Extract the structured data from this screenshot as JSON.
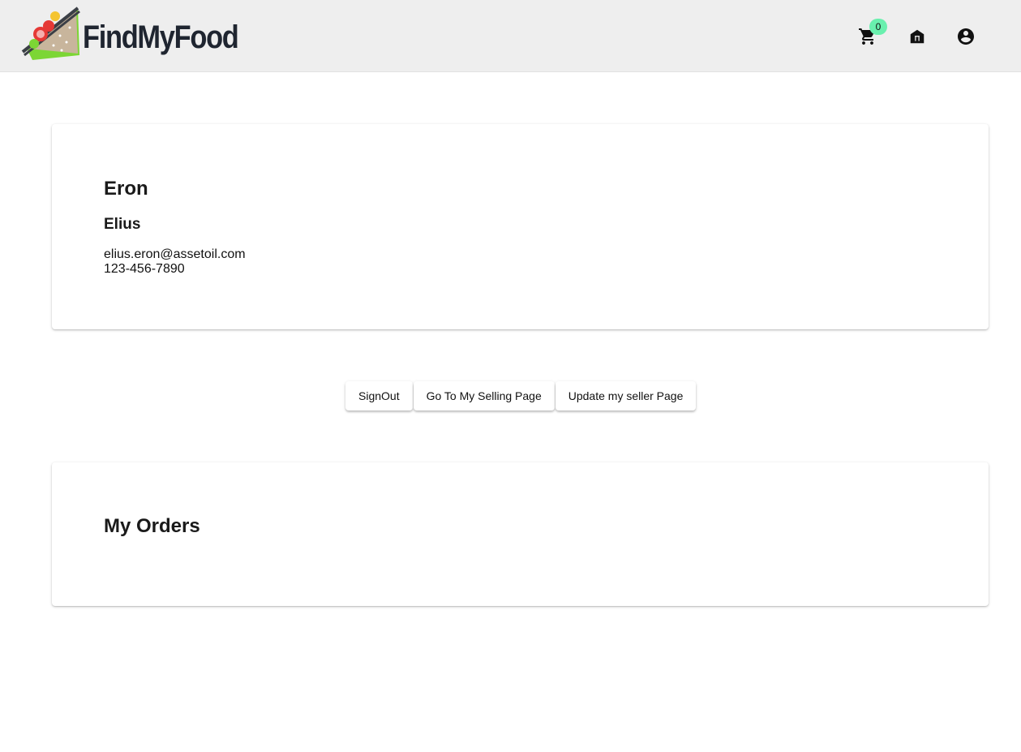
{
  "header": {
    "brand_name": "FindMyFood",
    "cart_count": "0",
    "icons": {
      "cart": "shopping-cart-icon",
      "store": "store-icon",
      "account": "account-circle-icon"
    }
  },
  "profile": {
    "last_name": "Eron",
    "first_name": "Elius",
    "email": "elius.eron@assetoil.com",
    "phone": "123-456-7890"
  },
  "actions": {
    "signout_label": "SignOut",
    "selling_page_label": "Go To My Selling Page",
    "update_seller_label": "Update my seller Page"
  },
  "orders": {
    "title": "My Orders"
  },
  "colors": {
    "appbar_bg": "#eeeeee",
    "badge": "#69f0ae",
    "brand_text": "#1f2530"
  }
}
